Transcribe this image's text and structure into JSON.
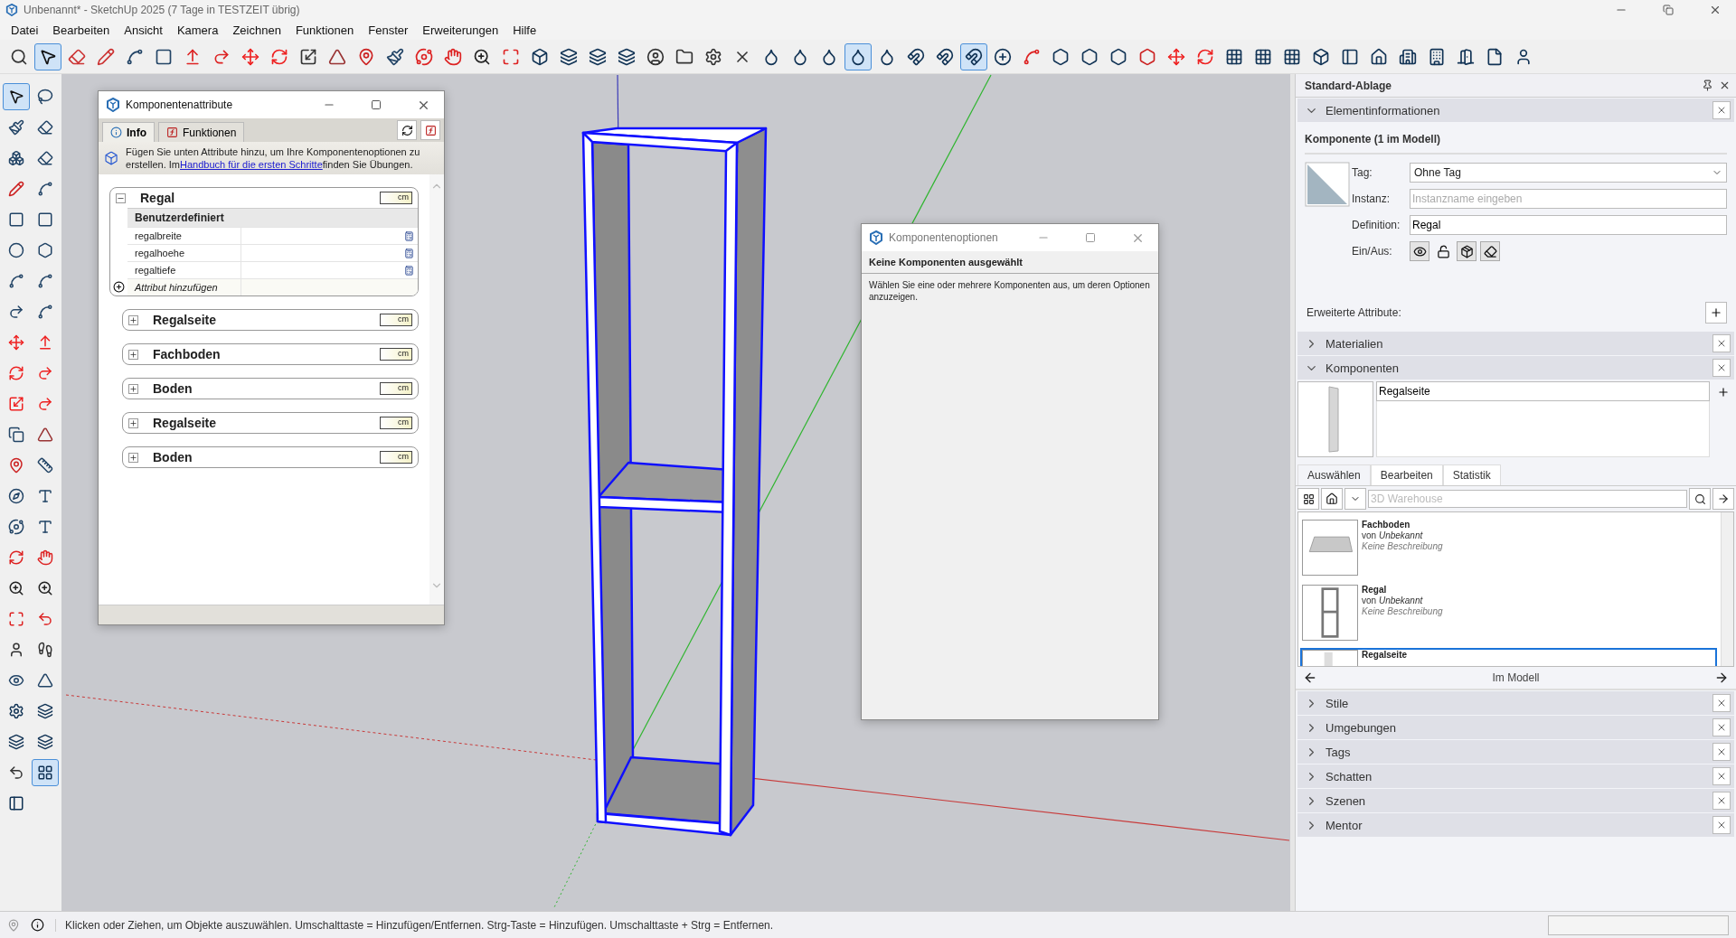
{
  "window": {
    "title": "Unbenannt* - SketchUp 2025 (7 Tage in TESTZEIT übrig)"
  },
  "menu": [
    "Datei",
    "Bearbeiten",
    "Ansicht",
    "Kamera",
    "Zeichnen",
    "Funktionen",
    "Fenster",
    "Erweiterungen",
    "Hilfe"
  ],
  "toolbar": {
    "tools": [
      {
        "selected": false
      },
      {
        "selected": true
      },
      {
        "selected": false
      },
      {
        "selected": false
      },
      {
        "selected": false
      },
      {
        "selected": false
      },
      {
        "selected": false
      },
      {
        "selected": false
      },
      {
        "selected": false
      },
      {
        "selected": false
      },
      {
        "selected": false
      },
      {
        "selected": false
      },
      {
        "selected": false
      },
      {
        "selected": false
      },
      {
        "selected": false
      },
      {
        "selected": false
      },
      {
        "selected": false
      },
      {
        "selected": false
      },
      {
        "selected": false
      },
      {
        "selected": false
      },
      {
        "selected": false
      },
      {
        "selected": false
      },
      {
        "selected": false
      },
      {
        "selected": false
      },
      {
        "selected": false
      },
      {
        "selected": false
      },
      {
        "selected": false
      },
      {
        "selected": false
      },
      {
        "selected": false
      },
      {
        "selected": true
      },
      {
        "selected": false
      },
      {
        "selected": false
      },
      {
        "selected": false
      },
      {
        "selected": true
      },
      {
        "selected": false
      },
      {
        "selected": false
      },
      {
        "selected": false
      },
      {
        "selected": false
      },
      {
        "selected": false
      },
      {
        "selected": false
      },
      {
        "selected": false
      },
      {
        "selected": false
      },
      {
        "selected": false
      },
      {
        "selected": false
      },
      {
        "selected": false
      },
      {
        "selected": false
      },
      {
        "selected": false
      },
      {
        "selected": false
      },
      {
        "selected": false
      },
      {
        "selected": false
      },
      {
        "selected": false
      },
      {
        "selected": false
      },
      {
        "selected": false
      }
    ]
  },
  "left_toolbar": {
    "tools": [
      {
        "selected": true
      },
      {
        "selected": false
      },
      {
        "selected": false
      },
      {
        "selected": false
      },
      {
        "selected": false
      },
      {
        "selected": false
      },
      {
        "selected": false
      },
      {
        "selected": false
      },
      {
        "selected": false
      },
      {
        "selected": false
      },
      {
        "selected": false
      },
      {
        "selected": false
      },
      {
        "selected": false
      },
      {
        "selected": false
      },
      {
        "selected": false
      },
      {
        "selected": false
      },
      {
        "selected": false
      },
      {
        "selected": false
      },
      {
        "selected": false
      },
      {
        "selected": false
      },
      {
        "selected": false
      },
      {
        "selected": false
      },
      {
        "selected": false
      },
      {
        "selected": false
      },
      {
        "selected": false
      },
      {
        "selected": false
      },
      {
        "selected": false
      },
      {
        "selected": false
      },
      {
        "selected": false
      },
      {
        "selected": false
      },
      {
        "selected": false
      },
      {
        "selected": false
      },
      {
        "selected": false
      },
      {
        "selected": false
      },
      {
        "selected": false
      },
      {
        "selected": false
      },
      {
        "selected": false
      },
      {
        "selected": false
      },
      {
        "selected": false
      },
      {
        "selected": false
      },
      {
        "selected": false
      },
      {
        "selected": false
      },
      {
        "selected": false
      },
      {
        "selected": false
      },
      {
        "selected": false
      },
      {
        "selected": true
      },
      {
        "selected": false
      }
    ]
  },
  "attributes_dialog": {
    "title": "Komponentenattribute",
    "tabs": [
      {
        "label": "Info",
        "selected": true
      },
      {
        "label": "Funktionen",
        "selected": false
      }
    ],
    "info_text": "Fügen Sie unten Attribute hinzu, um Ihre Komponentenoptionen zu erstellen. Im",
    "link": "Handbuch für die ersten Schritte",
    "info_tail": "finden Sie Übungen.",
    "groups": [
      {
        "name": "Regal",
        "expanded": true,
        "unit": "cm",
        "section": "Benutzerdefiniert",
        "attributes": [
          "regalbreite",
          "regalhoehe",
          "regaltiefe"
        ],
        "add_label": "Attribut hinzufügen"
      },
      {
        "name": "Regalseite",
        "expanded": false,
        "unit": "cm"
      },
      {
        "name": "Fachboden",
        "expanded": false,
        "unit": "cm"
      },
      {
        "name": "Boden",
        "expanded": false,
        "unit": "cm"
      },
      {
        "name": "Regalseite",
        "expanded": false,
        "unit": "cm"
      },
      {
        "name": "Boden",
        "expanded": false,
        "unit": "cm"
      }
    ]
  },
  "options_dialog": {
    "title": "Komponentenoptionen",
    "heading": "Keine Komponenten ausgewählt",
    "message": "Wählen Sie eine oder mehrere Komponenten aus, um deren Optionen anzuzeigen."
  },
  "tray": {
    "title": "Standard-Ablage",
    "panels": [
      {
        "title": "Elementinformationen",
        "expanded": true,
        "kind": "entity_info",
        "heading": "Komponente (1 im Modell)",
        "tag_label": "Tag:",
        "tag": "Ohne Tag",
        "instance_label": "Instanz:",
        "instance_placeholder": "Instanzname eingeben",
        "definition_label": "Definition:",
        "definition": "Regal",
        "toggles_label": "Ein/Aus:",
        "toggles": [
          {
            "on": true
          },
          {
            "on": false
          },
          {
            "on": true
          },
          {
            "on": true
          }
        ],
        "advanced_label": "Erweiterte Attribute:"
      },
      {
        "title": "Materialien",
        "expanded": false
      },
      {
        "title": "Komponenten",
        "expanded": true,
        "kind": "components",
        "name": "Regalseite",
        "tabs": [
          {
            "label": "Auswählen",
            "selected": true
          },
          {
            "label": "Bearbeiten",
            "selected": false
          },
          {
            "label": "Statistik",
            "selected": false
          }
        ],
        "search_placeholder": "3D Warehouse",
        "items": [
          {
            "name": "Fachboden",
            "author": "von *Unbekannt*",
            "description": "Keine Beschreibung",
            "selected": false
          },
          {
            "name": "Regal",
            "author": "von *Unbekannt*",
            "description": "Keine Beschreibung",
            "selected": false
          },
          {
            "name": "Regalseite",
            "selected": true
          }
        ],
        "footer": "Im Modell"
      },
      {
        "title": "Stile",
        "expanded": false
      },
      {
        "title": "Umgebungen",
        "expanded": false
      },
      {
        "title": "Tags",
        "expanded": false
      },
      {
        "title": "Schatten",
        "expanded": false
      },
      {
        "title": "Szenen",
        "expanded": false
      },
      {
        "title": "Mentor",
        "expanded": false
      }
    ]
  },
  "status_bar": {
    "text": "Klicken oder Ziehen, um Objekte auszuwählen. Umschalttaste = Hinzufügen/Entfernen. Strg-Taste = Hinzufügen. Umschalttaste + Strg = Entfernen."
  }
}
